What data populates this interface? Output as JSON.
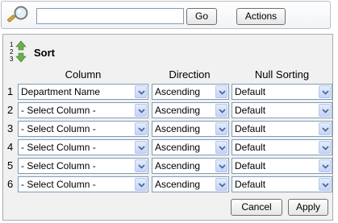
{
  "search": {
    "value": "",
    "go_label": "Go",
    "actions_label": "Actions"
  },
  "sort": {
    "title": "Sort",
    "headers": {
      "column": "Column",
      "direction": "Direction",
      "null_sorting": "Null Sorting"
    },
    "rows": [
      {
        "num": "1",
        "column": "Department Name",
        "direction": "Ascending",
        "null_sorting": "Default"
      },
      {
        "num": "2",
        "column": "- Select Column -",
        "direction": "Ascending",
        "null_sorting": "Default"
      },
      {
        "num": "3",
        "column": "- Select Column -",
        "direction": "Ascending",
        "null_sorting": "Default"
      },
      {
        "num": "4",
        "column": "- Select Column -",
        "direction": "Ascending",
        "null_sorting": "Default"
      },
      {
        "num": "5",
        "column": "- Select Column -",
        "direction": "Ascending",
        "null_sorting": "Default"
      },
      {
        "num": "6",
        "column": "- Select Column -",
        "direction": "Ascending",
        "null_sorting": "Default"
      }
    ],
    "cancel_label": "Cancel",
    "apply_label": "Apply"
  },
  "icons": {
    "search": "magnifier-icon",
    "sort": "sort-numbers-icon",
    "dropdown": "chevron-down-icon"
  },
  "colors": {
    "panel_bg": "#f1f1f1",
    "field_border": "#7f9db9",
    "dropdown_button": "#c3d3fd"
  }
}
